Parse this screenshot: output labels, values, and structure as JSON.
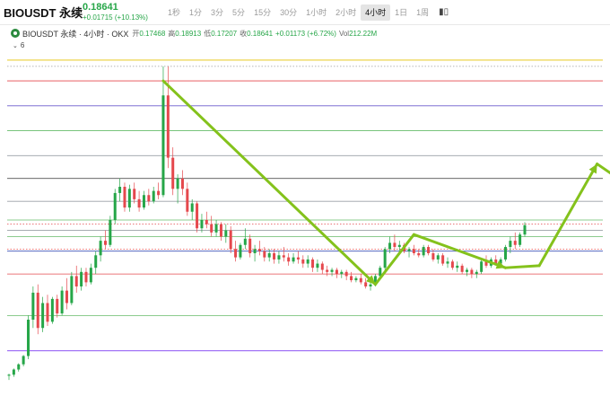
{
  "header": {
    "symbol": "BIOUSDT 永续",
    "last_price": "0.18641",
    "change": "+0.01715 (+10.13%)",
    "intervals": [
      {
        "label": "1秒",
        "active": false
      },
      {
        "label": "1分",
        "active": false
      },
      {
        "label": "3分",
        "active": false
      },
      {
        "label": "5分",
        "active": false
      },
      {
        "label": "15分",
        "active": false
      },
      {
        "label": "30分",
        "active": false
      },
      {
        "label": "1小时",
        "active": false
      },
      {
        "label": "2小时",
        "active": false
      },
      {
        "label": "4小时",
        "active": true
      },
      {
        "label": "1日",
        "active": false
      },
      {
        "label": "1周",
        "active": false
      }
    ],
    "tools": [
      {
        "icon": "candlestick-icon",
        "glyph": "▮▯"
      }
    ],
    "colors": {
      "up": "#26a648",
      "down": "#e5484d"
    }
  },
  "legend": {
    "title": "BIOUSDT 永续 · 4小时 · OKX",
    "open_label": "开",
    "open": "0.17468",
    "high_label": "高",
    "high": "0.18913",
    "low_label": "低",
    "low": "0.17207",
    "close_label": "收",
    "close": "0.18641",
    "change": "+0.01173 (+6.72%)",
    "vol_label": "Vol",
    "vol": "212.22M"
  },
  "layers": {
    "count": "6"
  },
  "chart_data": {
    "type": "candlestick",
    "candles": [
      [
        0.095,
        0.096,
        0.093,
        0.0955
      ],
      [
        0.0955,
        0.0985,
        0.0945,
        0.098
      ],
      [
        0.098,
        0.101,
        0.097,
        0.1005
      ],
      [
        0.1005,
        0.105,
        0.0995,
        0.1045
      ],
      [
        0.1045,
        0.124,
        0.103,
        0.122
      ],
      [
        0.122,
        0.138,
        0.118,
        0.135
      ],
      [
        0.135,
        0.139,
        0.115,
        0.118
      ],
      [
        0.118,
        0.133,
        0.116,
        0.13
      ],
      [
        0.13,
        0.134,
        0.119,
        0.121
      ],
      [
        0.121,
        0.133,
        0.12,
        0.132
      ],
      [
        0.132,
        0.134,
        0.123,
        0.125
      ],
      [
        0.125,
        0.138,
        0.124,
        0.136
      ],
      [
        0.136,
        0.142,
        0.127,
        0.13
      ],
      [
        0.13,
        0.145,
        0.129,
        0.143
      ],
      [
        0.143,
        0.148,
        0.135,
        0.138
      ],
      [
        0.138,
        0.147,
        0.136,
        0.145
      ],
      [
        0.145,
        0.147,
        0.138,
        0.14
      ],
      [
        0.14,
        0.149,
        0.139,
        0.147
      ],
      [
        0.147,
        0.155,
        0.144,
        0.153
      ],
      [
        0.153,
        0.162,
        0.15,
        0.16
      ],
      [
        0.16,
        0.165,
        0.156,
        0.158
      ],
      [
        0.158,
        0.172,
        0.157,
        0.17
      ],
      [
        0.17,
        0.185,
        0.168,
        0.183
      ],
      [
        0.183,
        0.19,
        0.179,
        0.186
      ],
      [
        0.186,
        0.188,
        0.174,
        0.176
      ],
      [
        0.176,
        0.187,
        0.174,
        0.185
      ],
      [
        0.185,
        0.188,
        0.178,
        0.18
      ],
      [
        0.18,
        0.184,
        0.174,
        0.176
      ],
      [
        0.176,
        0.184,
        0.175,
        0.182
      ],
      [
        0.182,
        0.185,
        0.177,
        0.179
      ],
      [
        0.179,
        0.186,
        0.178,
        0.184
      ],
      [
        0.184,
        0.188,
        0.18,
        0.182
      ],
      [
        0.182,
        0.244,
        0.181,
        0.23
      ],
      [
        0.23,
        0.244,
        0.195,
        0.2
      ],
      [
        0.2,
        0.205,
        0.182,
        0.185
      ],
      [
        0.185,
        0.192,
        0.178,
        0.19
      ],
      [
        0.19,
        0.194,
        0.182,
        0.185
      ],
      [
        0.185,
        0.188,
        0.172,
        0.174
      ],
      [
        0.174,
        0.18,
        0.17,
        0.178
      ],
      [
        0.178,
        0.179,
        0.164,
        0.166
      ],
      [
        0.166,
        0.173,
        0.164,
        0.17
      ],
      [
        0.17,
        0.174,
        0.166,
        0.168
      ],
      [
        0.168,
        0.172,
        0.162,
        0.164
      ],
      [
        0.164,
        0.17,
        0.162,
        0.168
      ],
      [
        0.168,
        0.169,
        0.16,
        0.162
      ],
      [
        0.162,
        0.168,
        0.159,
        0.165
      ],
      [
        0.165,
        0.167,
        0.154,
        0.156
      ],
      [
        0.156,
        0.16,
        0.15,
        0.152
      ],
      [
        0.152,
        0.159,
        0.151,
        0.158
      ],
      [
        0.158,
        0.166,
        0.156,
        0.161
      ],
      [
        0.161,
        0.163,
        0.152,
        0.154
      ],
      [
        0.154,
        0.158,
        0.15,
        0.156
      ],
      [
        0.156,
        0.16,
        0.153,
        0.155
      ],
      [
        0.155,
        0.157,
        0.15,
        0.152
      ],
      [
        0.152,
        0.156,
        0.15,
        0.154
      ],
      [
        0.154,
        0.156,
        0.149,
        0.151
      ],
      [
        0.151,
        0.155,
        0.149,
        0.153
      ],
      [
        0.153,
        0.157,
        0.15,
        0.152
      ],
      [
        0.152,
        0.154,
        0.148,
        0.15
      ],
      [
        0.15,
        0.154,
        0.149,
        0.152
      ],
      [
        0.152,
        0.155,
        0.149,
        0.151
      ],
      [
        0.151,
        0.153,
        0.147,
        0.149
      ],
      [
        0.149,
        0.153,
        0.147,
        0.151
      ],
      [
        0.151,
        0.152,
        0.145,
        0.147
      ],
      [
        0.147,
        0.151,
        0.145,
        0.149
      ],
      [
        0.149,
        0.15,
        0.144,
        0.146
      ],
      [
        0.146,
        0.148,
        0.143,
        0.145
      ],
      [
        0.145,
        0.147,
        0.143,
        0.146
      ],
      [
        0.146,
        0.147,
        0.142,
        0.144
      ],
      [
        0.144,
        0.146,
        0.142,
        0.145
      ],
      [
        0.145,
        0.146,
        0.141,
        0.143
      ],
      [
        0.143,
        0.145,
        0.14,
        0.141
      ],
      [
        0.141,
        0.143,
        0.14,
        0.142
      ],
      [
        0.142,
        0.144,
        0.139,
        0.14
      ],
      [
        0.14,
        0.142,
        0.137,
        0.138
      ],
      [
        0.138,
        0.14,
        0.136,
        0.139
      ],
      [
        0.139,
        0.144,
        0.138,
        0.143
      ],
      [
        0.143,
        0.148,
        0.142,
        0.147
      ],
      [
        0.147,
        0.157,
        0.146,
        0.156
      ],
      [
        0.156,
        0.162,
        0.154,
        0.159
      ],
      [
        0.159,
        0.163,
        0.155,
        0.157
      ],
      [
        0.157,
        0.16,
        0.154,
        0.158
      ],
      [
        0.158,
        0.159,
        0.154,
        0.155
      ],
      [
        0.155,
        0.157,
        0.152,
        0.156
      ],
      [
        0.156,
        0.158,
        0.153,
        0.154
      ],
      [
        0.154,
        0.156,
        0.152,
        0.153
      ],
      [
        0.153,
        0.158,
        0.152,
        0.157
      ],
      [
        0.157,
        0.158,
        0.153,
        0.154
      ],
      [
        0.154,
        0.156,
        0.15,
        0.151
      ],
      [
        0.151,
        0.154,
        0.149,
        0.153
      ],
      [
        0.153,
        0.154,
        0.148,
        0.149
      ],
      [
        0.149,
        0.152,
        0.147,
        0.15
      ],
      [
        0.15,
        0.151,
        0.146,
        0.147
      ],
      [
        0.147,
        0.15,
        0.145,
        0.148
      ],
      [
        0.148,
        0.149,
        0.144,
        0.145
      ],
      [
        0.145,
        0.147,
        0.143,
        0.146
      ],
      [
        0.146,
        0.147,
        0.142,
        0.144
      ],
      [
        0.144,
        0.146,
        0.142,
        0.145
      ],
      [
        0.145,
        0.151,
        0.144,
        0.15
      ],
      [
        0.15,
        0.153,
        0.147,
        0.148
      ],
      [
        0.148,
        0.152,
        0.147,
        0.151
      ],
      [
        0.151,
        0.153,
        0.148,
        0.149
      ],
      [
        0.149,
        0.152,
        0.148,
        0.151
      ],
      [
        0.151,
        0.158,
        0.15,
        0.157
      ],
      [
        0.157,
        0.162,
        0.154,
        0.16
      ],
      [
        0.16,
        0.164,
        0.156,
        0.158
      ],
      [
        0.158,
        0.164,
        0.157,
        0.163
      ],
      [
        0.163,
        0.169,
        0.162,
        0.1675
      ]
    ],
    "ylim": [
      0.09,
      0.25
    ],
    "horizontal_levels": [
      {
        "price": 0.247,
        "color": "#e5c100"
      },
      {
        "price": 0.237,
        "color": "#e5484d"
      },
      {
        "price": 0.225,
        "color": "#6a5acd"
      },
      {
        "price": 0.213,
        "color": "#66bb6a"
      },
      {
        "price": 0.201,
        "color": "#9aa0a6"
      },
      {
        "price": 0.19,
        "color": "#333333"
      },
      {
        "price": 0.179,
        "color": "#9aa0a6"
      },
      {
        "price": 0.17,
        "color": "#66bb6a"
      },
      {
        "price": 0.165,
        "color": "#9aa0a6"
      },
      {
        "price": 0.162,
        "color": "#66bb6a"
      },
      {
        "price": 0.155,
        "color": "#3f51b5"
      },
      {
        "price": 0.144,
        "color": "#e5484d"
      },
      {
        "price": 0.124,
        "color": "#66bb6a"
      },
      {
        "price": 0.107,
        "color": "#7e3ff2"
      }
    ],
    "dotted_levels": [
      {
        "price": 0.168,
        "color": "#e5484d"
      },
      {
        "price": 0.156,
        "color": "#e5484d"
      },
      {
        "price": 0.244,
        "color": "#9e9e9e"
      }
    ],
    "annotation_color": "#84c21c",
    "annotation_paths": [
      [
        [
          32,
          0.237
        ],
        [
          76,
          0.139
        ]
      ],
      [
        [
          76,
          0.139
        ],
        [
          84,
          0.163
        ]
      ],
      [
        [
          84,
          0.163
        ],
        [
          103,
          0.147
        ]
      ],
      [
        [
          103,
          0.147
        ],
        [
          110,
          0.148
        ]
      ],
      [
        [
          110,
          0.148
        ],
        [
          122,
          0.197
        ]
      ],
      [
        [
          122,
          0.197
        ],
        [
          127,
          0.189
        ]
      ],
      [
        [
          127,
          0.189
        ],
        [
          134,
          0.248
        ]
      ]
    ]
  }
}
